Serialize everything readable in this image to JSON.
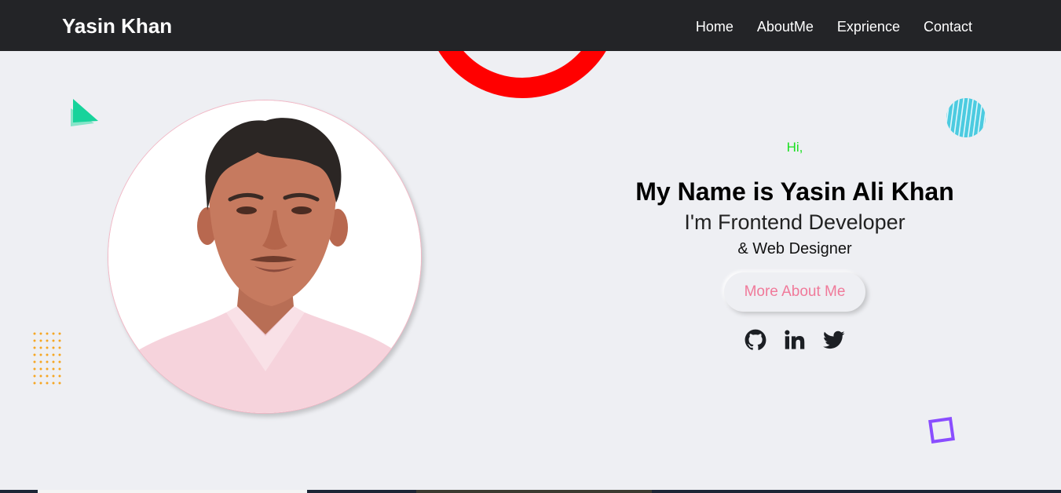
{
  "navbar": {
    "brand": "Yasin Khan",
    "links": [
      {
        "label": "Home"
      },
      {
        "label": "AboutMe"
      },
      {
        "label": "Exprience"
      },
      {
        "label": "Contact"
      }
    ]
  },
  "hero": {
    "greeting": "Hi,",
    "name": "My Name is Yasin Ali Khan",
    "role": "I'm Frontend Developer",
    "subrole": "& Web Designer",
    "cta_label": "More About Me",
    "socials": [
      {
        "icon": "github-icon"
      },
      {
        "icon": "linkedin-icon"
      },
      {
        "icon": "twitter-icon"
      }
    ]
  },
  "colors": {
    "navbar_bg": "#232427",
    "page_bg": "#eeeff3",
    "greeting": "#19e01f",
    "cta_text": "#f07a9a",
    "ring": "#ff0000",
    "triangle": "#22d3a0",
    "dots": "#f6a623",
    "striped_circle": "#4ccbe0",
    "square_outline": "#8a4dff"
  }
}
